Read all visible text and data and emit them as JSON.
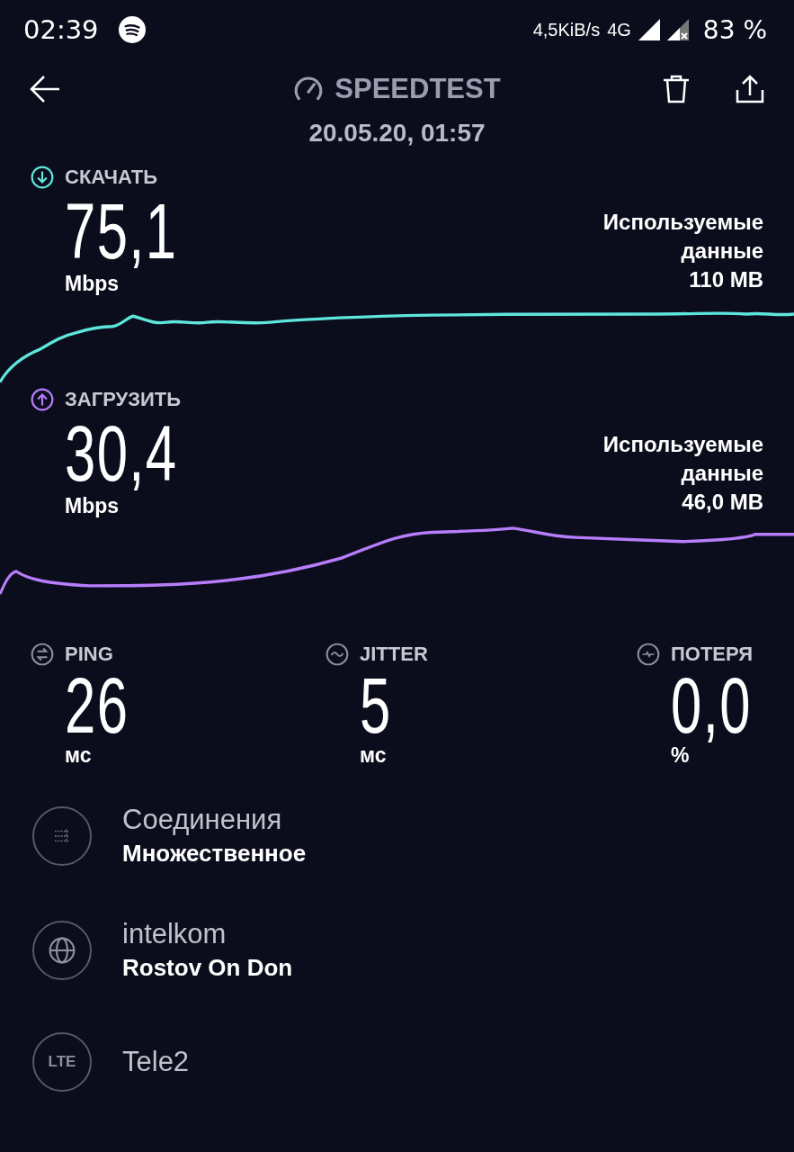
{
  "status_bar": {
    "time": "02:39",
    "net_speed": "4,5KiB/s",
    "network": "4G",
    "battery": "83 %"
  },
  "header": {
    "title": "SPEEDTEST",
    "date": "20.05.20, 01:57"
  },
  "results": [
    {
      "kind": "download",
      "label": "СКАЧАТЬ",
      "value": "75,1",
      "unit": "Mbps",
      "data_label": "Используемые данные",
      "data_value": "110 MB"
    },
    {
      "kind": "upload",
      "label": "ЗАГРУЗИТЬ",
      "value": "30,4",
      "unit": "Mbps",
      "data_label": "Используемые данные",
      "data_value": "46,0 MB"
    }
  ],
  "stats": [
    {
      "kind": "ping",
      "label": "PING",
      "value": "26",
      "unit": "мс"
    },
    {
      "kind": "jitter",
      "label": "JITTER",
      "value": "5",
      "unit": "мс"
    },
    {
      "kind": "loss",
      "label": "ПОТЕРЯ",
      "value": "0,0",
      "unit": "%"
    }
  ],
  "info": [
    {
      "kind": "connections",
      "title": "Соединения",
      "subtitle": "Множественное"
    },
    {
      "kind": "server",
      "title": "intelkom",
      "subtitle": "Rostov On Don"
    },
    {
      "kind": "carrier",
      "icon_text": "LTE",
      "title": "Tele2"
    }
  ]
}
